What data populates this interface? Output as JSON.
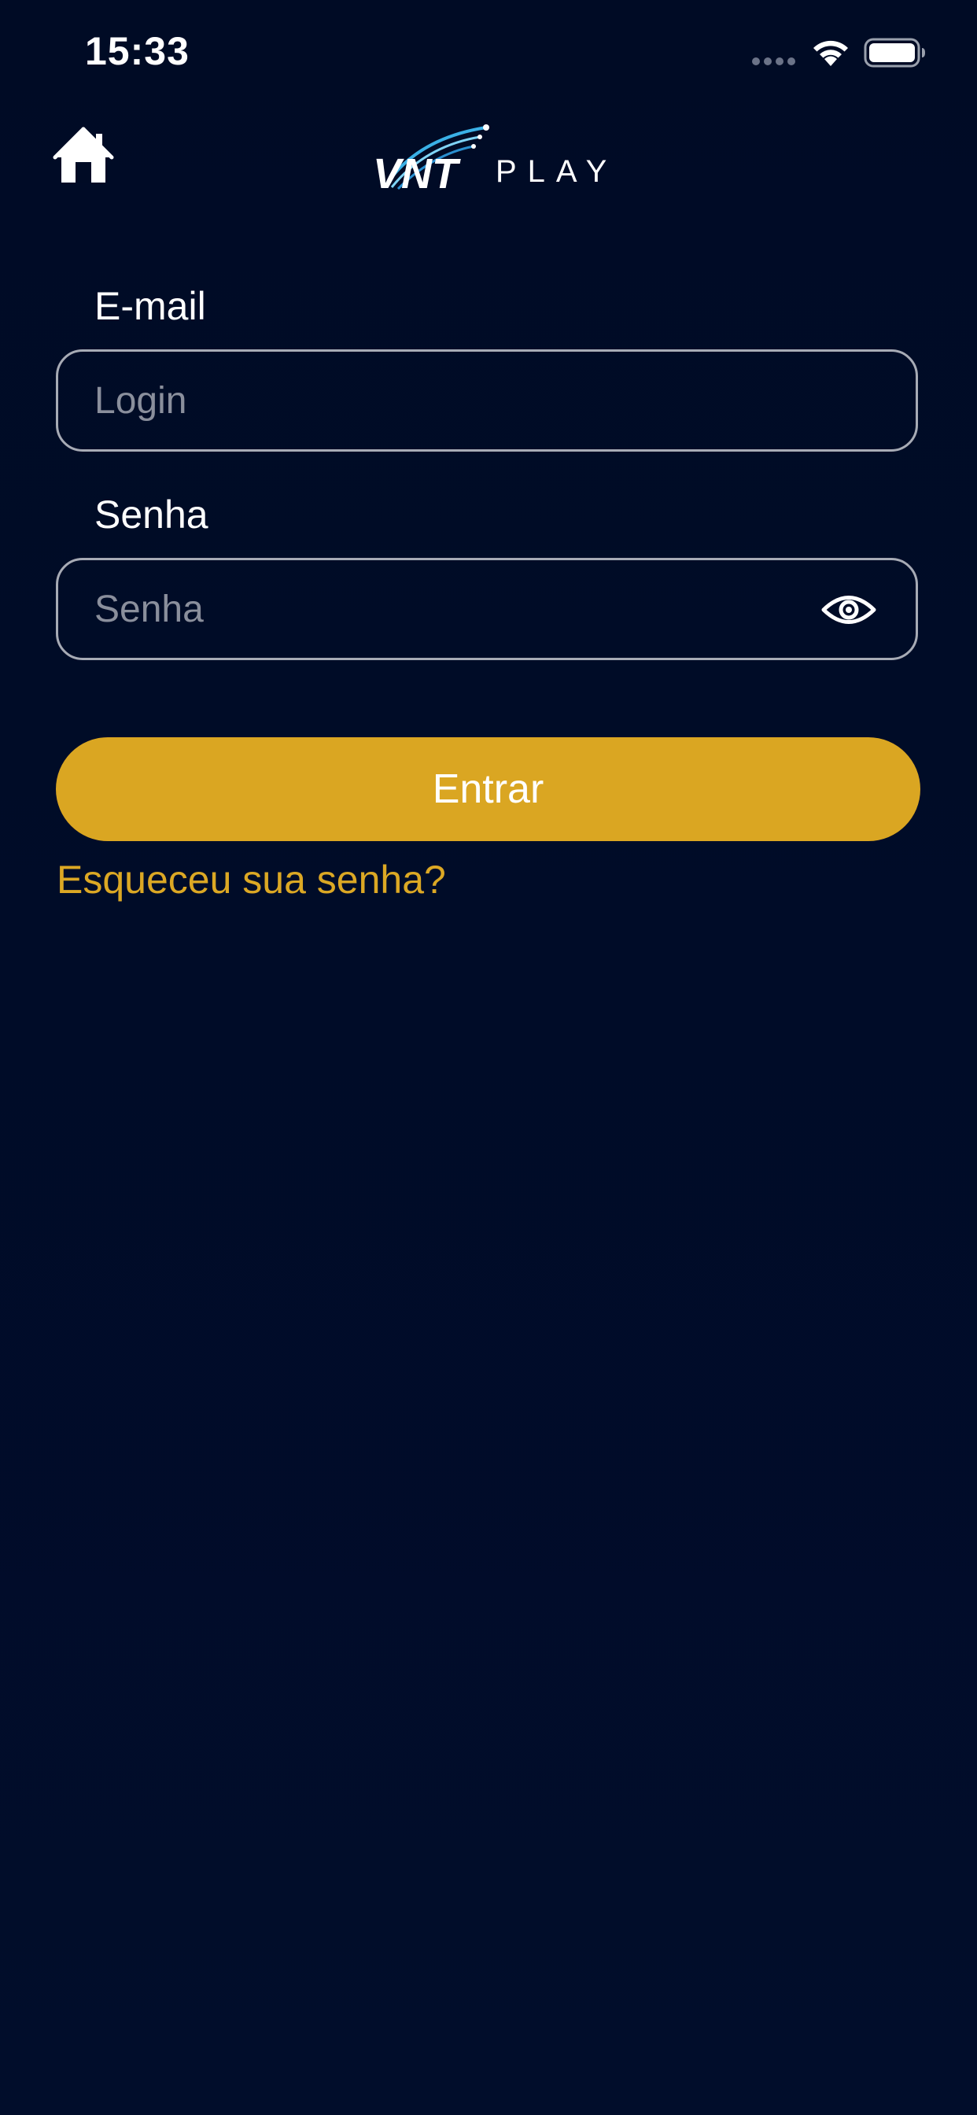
{
  "status_bar": {
    "time": "15:33",
    "icons": [
      "signal-dots-icon",
      "wifi-icon",
      "battery-icon"
    ]
  },
  "header": {
    "home_icon": "home-icon",
    "logo_text": "VNT",
    "logo_suffix": "PLAY"
  },
  "form": {
    "email": {
      "label": "E-mail",
      "placeholder": "Login",
      "value": ""
    },
    "password": {
      "label": "Senha",
      "placeholder": "Senha",
      "value": "",
      "toggle_icon": "eye-icon"
    },
    "submit_label": "Entrar",
    "forgot_label": "Esqueceu sua senha?"
  },
  "colors": {
    "background": "#000b25",
    "accent": "#daa622",
    "link": "#dca824",
    "field_border": "#a7abb5",
    "placeholder": "#8a8f9c",
    "logo_arc": "#3ab0e6"
  }
}
